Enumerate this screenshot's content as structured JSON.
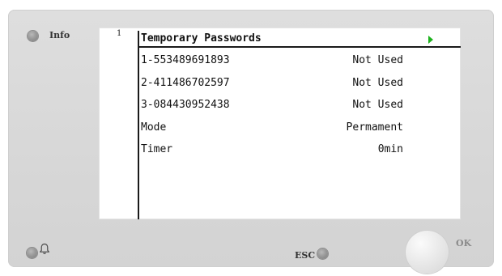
{
  "side": {
    "info_label": "Info",
    "esc_label": "ESC",
    "ok_label": "OK"
  },
  "screen": {
    "page_number": "1",
    "title": "Temporary Passwords",
    "rows": [
      {
        "label": "1-553489691893",
        "value": "Not Used"
      },
      {
        "label": "2-411486702597",
        "value": "Not Used"
      },
      {
        "label": "3-084430952438",
        "value": "Not Used"
      },
      {
        "label": "Mode",
        "value": "Permament"
      },
      {
        "label": "Timer",
        "value": "0min"
      }
    ]
  },
  "icons": {
    "alarm": "bell-icon",
    "next": "play-arrow-icon"
  },
  "colors": {
    "panel": "#d9d9d9",
    "screen_bg": "#ffffff",
    "arrow": "#1db21d",
    "text": "#111111"
  }
}
